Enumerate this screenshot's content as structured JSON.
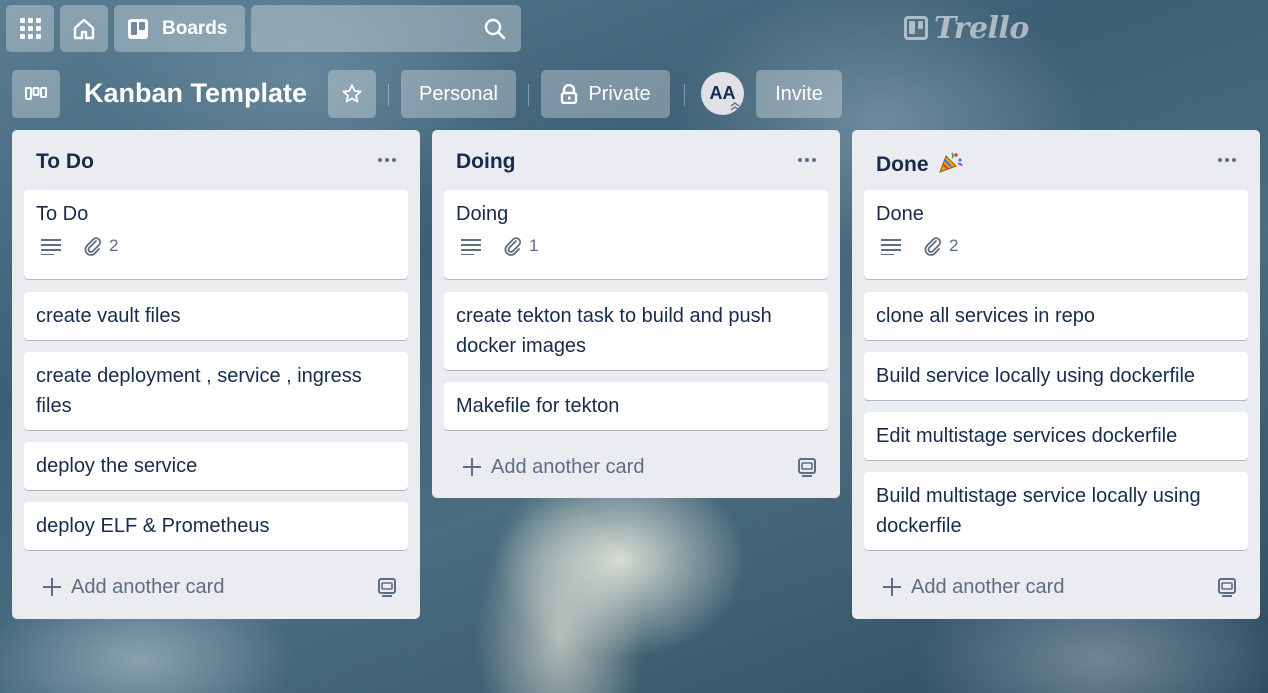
{
  "app": {
    "logo_text": "Trello"
  },
  "topbar": {
    "boards_label": "Boards",
    "icons": [
      "apps-grid-icon",
      "home-icon",
      "boards-icon",
      "search-icon"
    ]
  },
  "board": {
    "title": "Kanban Template",
    "team_label": "Personal",
    "visibility_label": "Private",
    "member_initials": "AA",
    "invite_label": "Invite"
  },
  "colors": {
    "list_bg": "#ebecf0",
    "card_bg": "#ffffff",
    "text_primary": "#172b4d",
    "text_secondary": "#5e6c84",
    "header_button_bg": "rgba(255,255,255,0.30)"
  },
  "lists": [
    {
      "title": "To Do",
      "title_emoji": "",
      "add_card_label": "Add another card",
      "cards": [
        {
          "title": "To Do",
          "has_description": true,
          "attachments": "2"
        },
        {
          "title": "create vault files"
        },
        {
          "title": "create deployment , service , ingress files"
        },
        {
          "title": "deploy the service"
        },
        {
          "title": "deploy ELF & Prometheus"
        }
      ]
    },
    {
      "title": "Doing",
      "title_emoji": "",
      "add_card_label": "Add another card",
      "cards": [
        {
          "title": "Doing",
          "has_description": true,
          "attachments": "1"
        },
        {
          "title": "create tekton task to build and push docker images"
        },
        {
          "title": "Makefile for tekton"
        }
      ]
    },
    {
      "title": "Done",
      "title_emoji": "party-popper-icon",
      "add_card_label": "Add another card",
      "cards": [
        {
          "title": "Done",
          "has_description": true,
          "attachments": "2"
        },
        {
          "title": "clone all services in repo"
        },
        {
          "title": "Build service locally using dockerfile"
        },
        {
          "title": "Edit multistage services dockerfile"
        },
        {
          "title": "Build multistage service locally using dockerfile"
        }
      ]
    }
  ]
}
